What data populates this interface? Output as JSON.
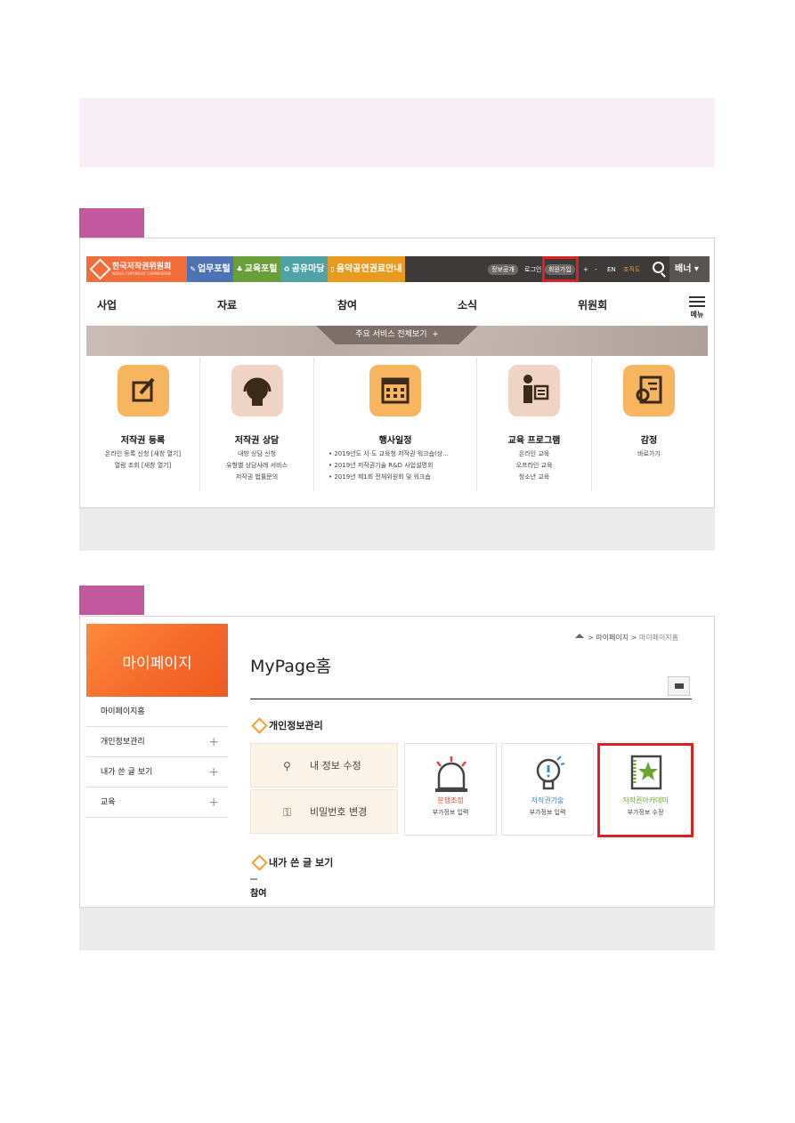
{
  "colors": {
    "accent_pink": "#c2599f",
    "brand_orange": "#f36d3b",
    "highlight_red": "#e02020"
  },
  "screenshot1": {
    "brand": {
      "name": "한국저작권위원회",
      "sub": "KOREA COPYRIGHT COMMISSION"
    },
    "portals": [
      {
        "label": "업무포털",
        "icon": "pencil-icon",
        "color": "#4e73b4"
      },
      {
        "label": "교육포털",
        "icon": "mic-icon",
        "color": "#6a9e3a"
      },
      {
        "label": "공유마당",
        "icon": "share-icon",
        "color": "#4fa3a7"
      },
      {
        "label": "음악공연권료안내",
        "icon": "book-icon",
        "color": "#e79a1e"
      }
    ],
    "top_links": [
      "정보공개",
      "로그인",
      "회원가입",
      "+",
      "-",
      "EN",
      "조직도"
    ],
    "banner_label": "배너",
    "nav": [
      "사업",
      "자료",
      "참여",
      "소식",
      "위원회"
    ],
    "menu_label": "메뉴",
    "service_tab": "주요 서비스 전체보기",
    "services": [
      {
        "title": "저작권 등록",
        "icon": "edit-icon",
        "lines": [
          "온라인 등록 신청 [새창 열기]",
          "열람 조회 [새창 열기]"
        ]
      },
      {
        "title": "저작권 상담",
        "icon": "headset-icon",
        "lines": [
          "내방 상담 신청",
          "유형별 상담사례 서비스",
          "저작권 법률문의"
        ]
      },
      {
        "title": "행사일정",
        "icon": "calendar-icon",
        "lines": [
          "• 2019년도 시·도 교육청 저작권 워크숍(상...",
          "• 2019년 저작권기술 R&D 사업설명회",
          "• 2019년 제1회 전체위원회 및 워크숍"
        ]
      },
      {
        "title": "교육 프로그램",
        "icon": "teacher-icon",
        "lines": [
          "온라인 교육",
          "오프라인 교육",
          "청소년 교육"
        ]
      },
      {
        "title": "감정",
        "icon": "document-search-icon",
        "lines": [
          "바로가기"
        ]
      }
    ]
  },
  "screenshot2": {
    "sidebar_title": "마이페이지",
    "sidebar_items": [
      {
        "label": "마이페이지홈",
        "expand": ""
      },
      {
        "label": "개인정보관리",
        "expand": "+"
      },
      {
        "label": "내가 쓴 글 보기",
        "expand": "+"
      },
      {
        "label": "교육",
        "expand": "+"
      }
    ],
    "breadcrumb": [
      "마이페이지",
      "마이페이지홈"
    ],
    "breadcrumb_sep": ">",
    "page_title": "MyPage홈",
    "section_personal": "개인정보관리",
    "info_buttons": [
      {
        "label": "내 정보 수정",
        "icon": "search-icon"
      },
      {
        "label": "비밀번호 변경",
        "icon": "key-icon"
      }
    ],
    "cards": [
      {
        "title": "분쟁조정",
        "sub": "부가정보 입력",
        "icon": "siren-icon",
        "color": "#e0463a"
      },
      {
        "title": "저작권기술",
        "sub": "부가정보 입력",
        "icon": "lightbulb-icon",
        "color": "#3b8ed0"
      },
      {
        "title": "저작권아카데미",
        "sub": "부가정보 수정",
        "icon": "star-book-icon",
        "color": "#6aa531"
      }
    ],
    "section_posts": "내가 쓴 글 보기",
    "posts_first_item": "참여"
  }
}
